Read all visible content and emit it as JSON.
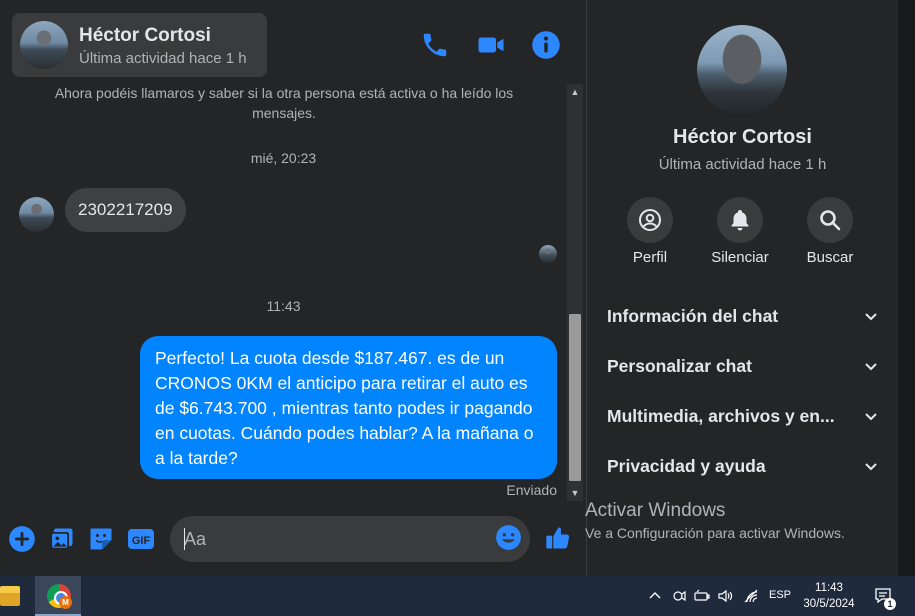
{
  "colors": {
    "accent": "#0084ff",
    "icon_blue": "#2d88ff",
    "background": "#242526",
    "bubble_received": "#3e4042",
    "text_secondary": "#b0b3b8"
  },
  "header": {
    "name": "Héctor Cortosi",
    "status": "Última actividad hace 1 h",
    "icons": [
      "phone-icon",
      "video-camera-icon",
      "info-icon"
    ]
  },
  "conversation": {
    "notice": "Ahora podéis llamaros y saber si la otra persona está activa o ha leído los mensajes.",
    "timestamp_1": "mié, 20:23",
    "received_message": "2302217209",
    "timestamp_2": "11:43",
    "sent_message": "Perfecto! La cuota desde $187.467. es de un CRONOS 0KM el anticipo para retirar el auto es de $6.743.700 , mientras tanto podes ir pagando en cuotas. Cuándo podes hablar? A la mañana o a la tarde?",
    "sent_status": "Enviado"
  },
  "composer": {
    "placeholder": "Aa",
    "icons": [
      "plus-icon",
      "photo-icon",
      "sticker-icon",
      "gif-icon",
      "emoji-icon",
      "thumbs-up-icon"
    ],
    "gif_label": "GIF"
  },
  "panel": {
    "name": "Héctor Cortosi",
    "status": "Última actividad hace 1 h",
    "actions": [
      {
        "label": "Perfil",
        "icon": "profile-icon"
      },
      {
        "label": "Silenciar",
        "icon": "bell-icon"
      },
      {
        "label": "Buscar",
        "icon": "search-icon"
      }
    ],
    "sections": [
      {
        "label": "Información del chat"
      },
      {
        "label": "Personalizar chat"
      },
      {
        "label": "Multimedia, archivos y en..."
      },
      {
        "label": "Privacidad y ayuda"
      }
    ]
  },
  "watermark": {
    "title": "Activar Windows",
    "subtitle": "Ve a Configuración para activar Windows."
  },
  "taskbar": {
    "chrome_badge": "M",
    "language": "ESP",
    "time": "11:43",
    "date": "30/5/2024",
    "notification_count": "1"
  }
}
